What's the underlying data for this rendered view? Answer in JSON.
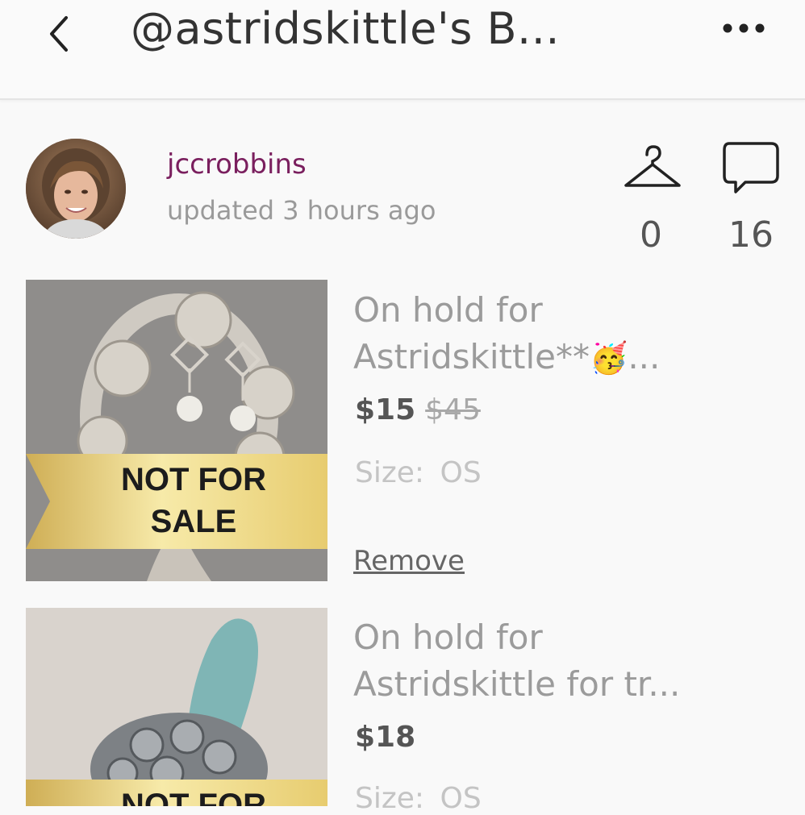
{
  "header": {
    "title": "@astridskittle's B...",
    "back_icon": "chevron-left-icon",
    "more_icon": "more-horizontal-icon"
  },
  "owner": {
    "username": "jccrobbins",
    "updated": "updated 3 hours ago",
    "likes_count": "0",
    "comments_count": "16",
    "likes_icon": "hanger-icon",
    "comments_icon": "speech-bubble-icon"
  },
  "listings": [
    {
      "title_line1": "On hold for",
      "title_line2": "Astridskittle**",
      "title_emoji": "🥳",
      "title_ellipsis": "...",
      "price": "$15",
      "original_price": "$45",
      "size_label": "Size:",
      "size_value": "OS",
      "action": "Remove",
      "banner_line1": "NOT FOR",
      "banner_line2": "SALE"
    },
    {
      "title_line1": "On hold for",
      "title_line2": "Astridskittle for tr...",
      "price": "$18",
      "size_label": "Size:",
      "size_value": "OS",
      "banner_line1": "NOT FOR"
    }
  ],
  "colors": {
    "username": "#7a1f5e",
    "banner_gold": "#f1dc8a"
  }
}
